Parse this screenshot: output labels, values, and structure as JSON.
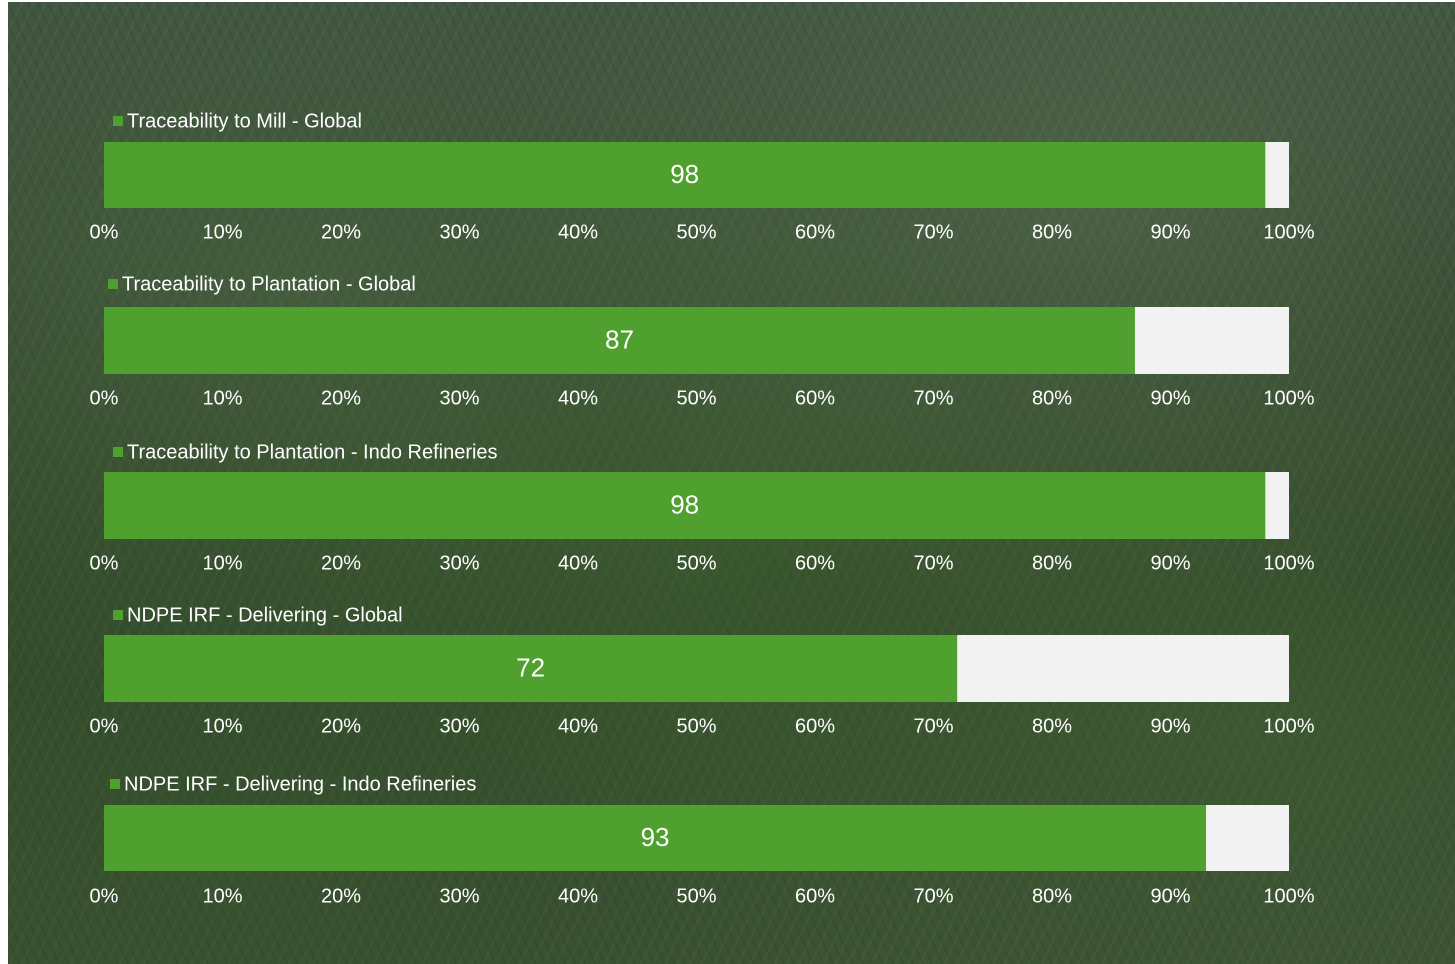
{
  "chart_data": [
    {
      "type": "bar",
      "orientation": "horizontal",
      "stacked": "100%",
      "series": [
        {
          "name": "Traceability to Mill - Global",
          "values": [
            98
          ]
        }
      ],
      "remainder_color": "#f2f2f2",
      "xlim": [
        0,
        100
      ],
      "x_ticks": [
        "0%",
        "10%",
        "20%",
        "30%",
        "40%",
        "50%",
        "60%",
        "70%",
        "80%",
        "90%",
        "100%"
      ],
      "data_labels": [
        "98"
      ]
    },
    {
      "type": "bar",
      "orientation": "horizontal",
      "stacked": "100%",
      "series": [
        {
          "name": "Traceability to Plantation  - Global",
          "values": [
            87
          ]
        }
      ],
      "remainder_color": "#f2f2f2",
      "xlim": [
        0,
        100
      ],
      "x_ticks": [
        "0%",
        "10%",
        "20%",
        "30%",
        "40%",
        "50%",
        "60%",
        "70%",
        "80%",
        "90%",
        "100%"
      ],
      "data_labels": [
        "87"
      ]
    },
    {
      "type": "bar",
      "orientation": "horizontal",
      "stacked": "100%",
      "series": [
        {
          "name": "Traceability to Plantation  - Indo Refineries",
          "values": [
            98
          ]
        }
      ],
      "remainder_color": "#f2f2f2",
      "xlim": [
        0,
        100
      ],
      "x_ticks": [
        "0%",
        "10%",
        "20%",
        "30%",
        "40%",
        "50%",
        "60%",
        "70%",
        "80%",
        "90%",
        "100%"
      ],
      "data_labels": [
        "98"
      ]
    },
    {
      "type": "bar",
      "orientation": "horizontal",
      "stacked": "100%",
      "series": [
        {
          "name": "NDPE IRF - Delivering - Global",
          "values": [
            72
          ]
        }
      ],
      "remainder_color": "#f2f2f2",
      "xlim": [
        0,
        100
      ],
      "x_ticks": [
        "0%",
        "10%",
        "20%",
        "30%",
        "40%",
        "50%",
        "60%",
        "70%",
        "80%",
        "90%",
        "100%"
      ],
      "data_labels": [
        "72"
      ]
    },
    {
      "type": "bar",
      "orientation": "horizontal",
      "stacked": "100%",
      "series": [
        {
          "name": "NDPE IRF - Delivering - Indo Refineries",
          "values": [
            93
          ]
        }
      ],
      "remainder_color": "#f2f2f2",
      "xlim": [
        0,
        100
      ],
      "x_ticks": [
        "0%",
        "10%",
        "20%",
        "30%",
        "40%",
        "50%",
        "60%",
        "70%",
        "80%",
        "90%",
        "100%"
      ],
      "data_labels": [
        "93"
      ]
    }
  ],
  "colors": {
    "bar_fill": "#50a02f",
    "track_fill": "#f2f2f2",
    "text": "#ffffff",
    "background": "#3a4d35"
  }
}
